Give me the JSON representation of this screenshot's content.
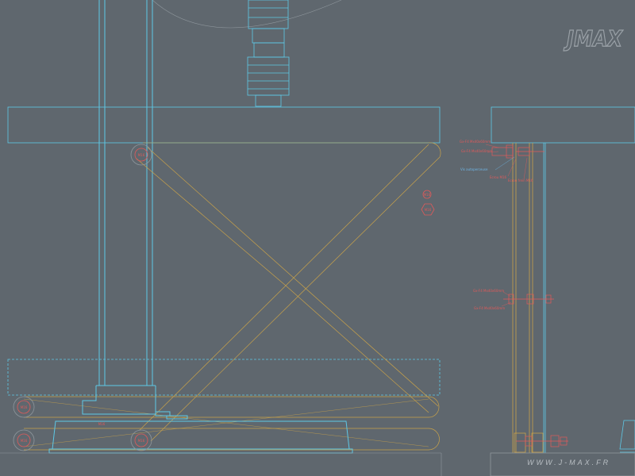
{
  "callouts": [
    "Gx-F4 Mx40x60mm",
    "Gx-F4 Mx40x60mm",
    "Vis autoperceuse",
    "Ecrou M16",
    "Ecrou frein M16",
    "Gx-F4 Mx40x60mm",
    "Gx-F4 Mx40x60mm"
  ],
  "bolt_tags": [
    "M16",
    "M16",
    "M16",
    "M16",
    "M16",
    "M16",
    "M16"
  ],
  "footer": {
    "website": "WWW.J-MAX.FR"
  },
  "logo": {
    "text": "JMAX"
  },
  "colors": {
    "background": "#5f676e",
    "frame": "#5ec8e6",
    "scissor": "#c9a24a",
    "bolt": "#e05a5a",
    "dim": "#8f979d"
  }
}
